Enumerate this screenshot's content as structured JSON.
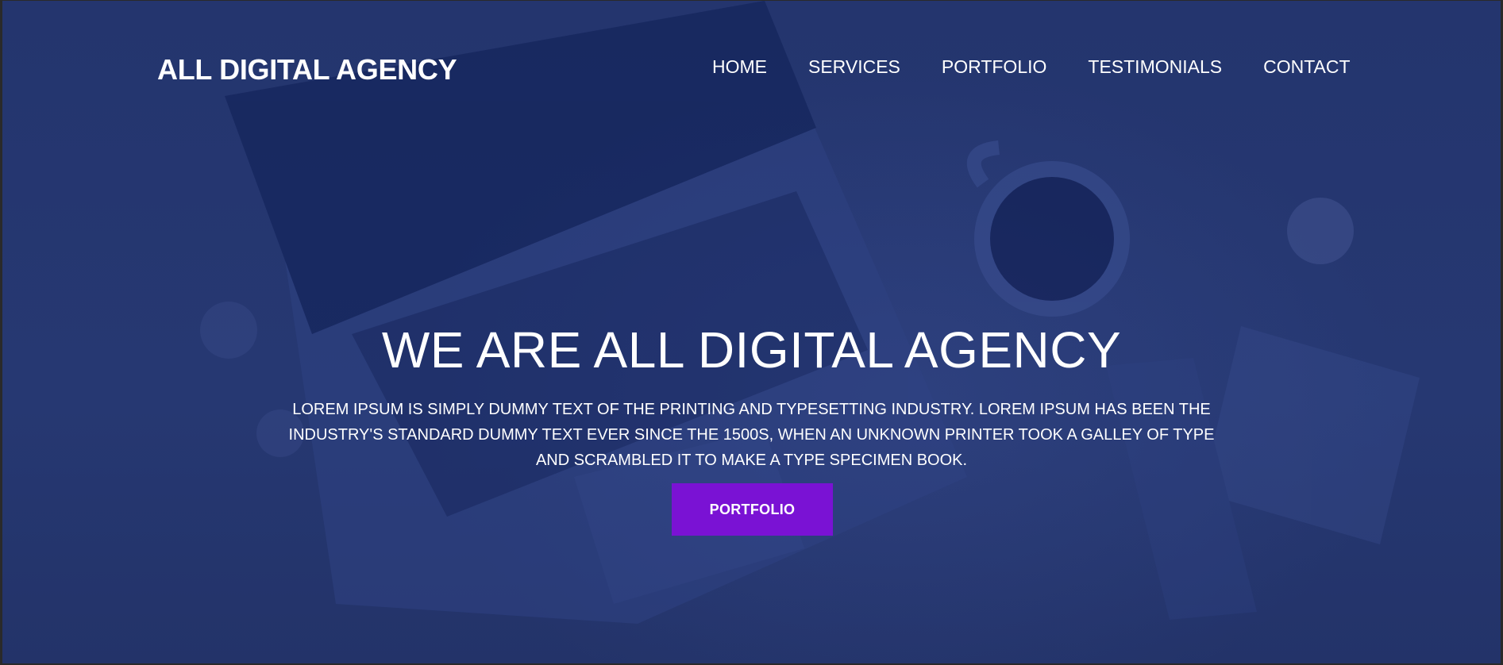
{
  "brand": {
    "name": "ALL DIGITAL AGENCY"
  },
  "nav": {
    "items": [
      {
        "label": "HOME"
      },
      {
        "label": "SERVICES"
      },
      {
        "label": "PORTFOLIO"
      },
      {
        "label": "TESTIMONIALS"
      },
      {
        "label": "CONTACT"
      }
    ]
  },
  "hero": {
    "headline": "WE ARE ALL DIGITAL AGENCY",
    "description": "LOREM IPSUM IS SIMPLY DUMMY TEXT OF THE PRINTING AND TYPESETTING INDUSTRY. LOREM IPSUM HAS BEEN THE INDUSTRY'S STANDARD DUMMY TEXT EVER SINCE THE 1500S, WHEN AN UNKNOWN PRINTER TOOK A GALLEY OF TYPE AND SCRAMBLED IT TO MAKE A TYPE SPECIMEN BOOK.",
    "cta_label": "PORTFOLIO"
  },
  "colors": {
    "overlay": "#24356e",
    "accent": "#7a12d4",
    "text": "#ffffff"
  }
}
